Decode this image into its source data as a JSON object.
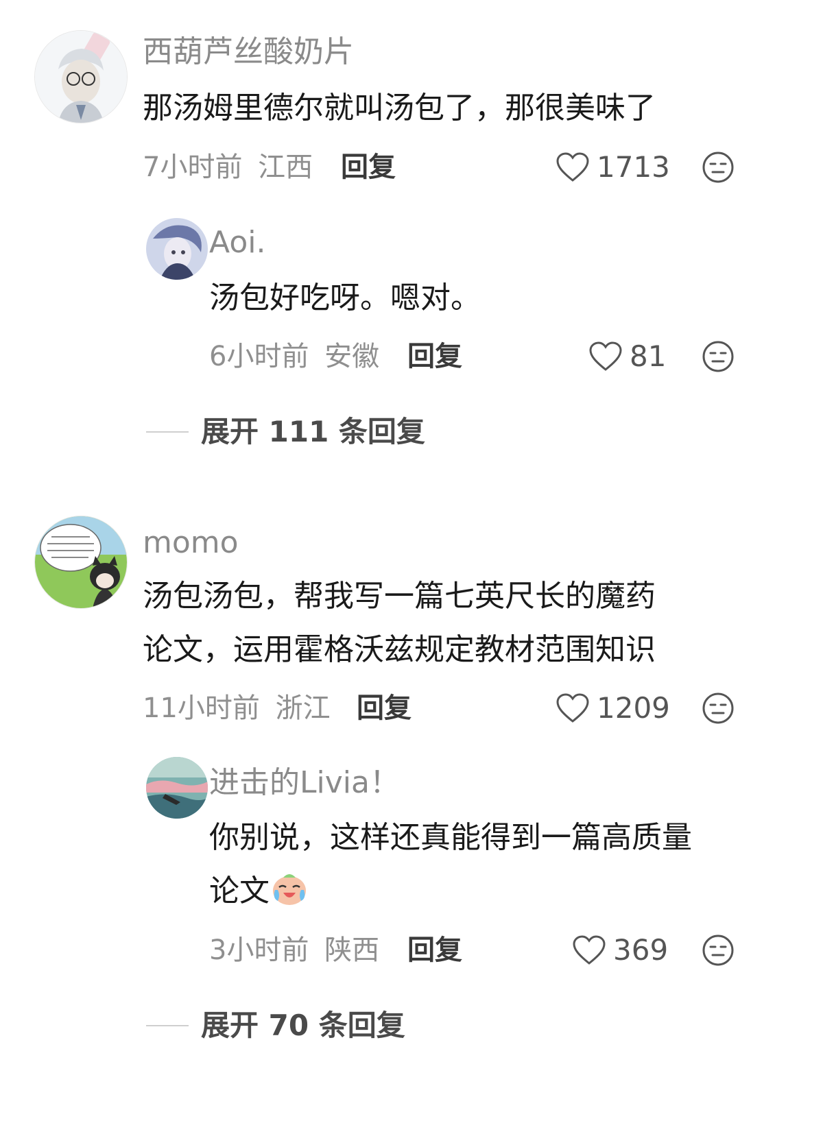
{
  "comments": [
    {
      "username": "西葫芦丝酸奶片",
      "text": "那汤姆里德尔就叫汤包了，那很美味了",
      "time": "7小时前",
      "location": "江西",
      "reply_label": "回复",
      "likes": "1713",
      "avatar_icon": "avatar-white-hair-boy",
      "replies": [
        {
          "username": "Aoi.",
          "text": "汤包好吃呀。嗯对。",
          "time": "6小时前",
          "location": "安徽",
          "reply_label": "回复",
          "likes": "81",
          "avatar_icon": "avatar-anime-blue"
        }
      ],
      "expand_label": "展开 111 条回复"
    },
    {
      "username": "momo",
      "text_line1": "汤包汤包，帮我写一篇七英尺长的魔药",
      "text_line2": "论文，运用霍格沃兹规定教材范围知识",
      "time": "11小时前",
      "location": "浙江",
      "reply_label": "回复",
      "likes": "1209",
      "avatar_icon": "avatar-cat-boy-grass",
      "replies": [
        {
          "username": "进击的Livia！",
          "text_line1": "你别说，这样还真能得到一篇高质量",
          "text_line2": "论文",
          "emoji": "crying-laughing-emoji",
          "time": "3小时前",
          "location": "陕西",
          "reply_label": "回复",
          "likes": "369",
          "avatar_icon": "avatar-landscape-teal"
        }
      ],
      "expand_label": "展开 70 条回复"
    }
  ],
  "icons": {
    "like": "heart-outline-icon",
    "reaction": "neutral-face-icon"
  },
  "colors": {
    "username": "#8a8a8a",
    "text": "#1a1a1a",
    "meta": "#8f8f8f",
    "reply": "#3a3a3a"
  }
}
